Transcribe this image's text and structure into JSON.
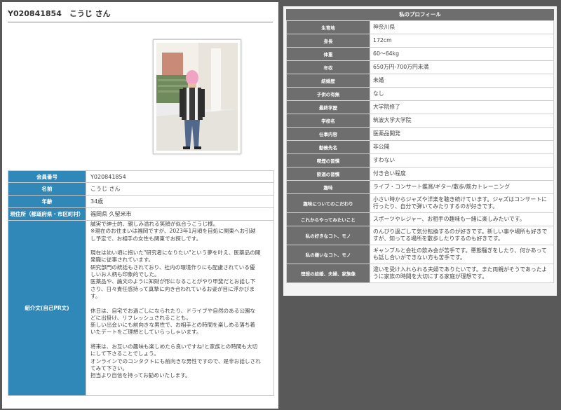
{
  "member": {
    "header": "Y020841854　こうじ さん",
    "rows": [
      {
        "label": "会員番号",
        "value": "Y020841854"
      },
      {
        "label": "名前",
        "value": "こうじ さん"
      },
      {
        "label": "年齢",
        "value": "34歳"
      },
      {
        "label": "現住所（都道府県・市区町村）",
        "value": "福岡県 久留米市"
      }
    ],
    "pr_label": "紹介文(自己PR文)",
    "pr_lines": [
      "誠実で紳士的、親しみ溢れる笑顔が似合うこうじ様。",
      "※現在のお住まいは福岡ですが、2023年1月頃を目処に関東へお引越",
      "し予定で、お相手の女性も関東でお探しです。",
      "",
      "現在は幼い頃に抱いた\"研究者になりたい\"という夢を叶え、医薬品の開",
      "発職に従事されています。",
      "研究部門の統括もされており、社内の環境作りにも配慮されている優",
      "しいお人柄も印象的でした。",
      "医薬品や、論文のように知財が形になることがやり甲斐だとお話し下",
      "さり、日々責任感持って真摯に向き合われているお姿が目に浮かびま",
      "す。",
      "",
      "休日は、自宅でお過ごしになられたり、ドライブや自然のある公園な",
      "どに出掛け、リフレッシュされることも。",
      "新しい出会いにも前向きな男性で、お相手との時間を楽しめる落ち着",
      "いたデートをご理想としていらっしゃいます。",
      "",
      "将来は、お互いの趣味も楽しめたら良いですね!と家族との時間も大切",
      "にして下さることでしょう。",
      "オンラインでのコンタクトにも前向きな男性ですので、是非お話しされ",
      "てみて下さい。",
      "担当より自信を持ってお勧めいたします。"
    ]
  },
  "profile": {
    "title": "私のプロフィール",
    "rows": [
      {
        "label": "生育地",
        "value": "神奈川県"
      },
      {
        "label": "身長",
        "value": "172cm"
      },
      {
        "label": "体重",
        "value": "60〜64kg"
      },
      {
        "label": "年収",
        "value": "650万円-700万円未満"
      },
      {
        "label": "結婚歴",
        "value": "未婚"
      },
      {
        "label": "子供の有無",
        "value": "なし"
      },
      {
        "label": "最終学歴",
        "value": "大学院修了"
      },
      {
        "label": "学校名",
        "value": "筑波大学大学院"
      },
      {
        "label": "仕事内容",
        "value": "医薬品開発"
      },
      {
        "label": "勤務先名",
        "value": "非公開"
      },
      {
        "label": "喫煙の習慣",
        "value": "すわない"
      },
      {
        "label": "飲酒の習慣",
        "value": "付き合い程度"
      },
      {
        "label": "趣味",
        "value": "ライブ・コンサート鑑賞/ギター/散歩/筋力トレーニング"
      },
      {
        "label": "趣味についてのこだわり",
        "value": "小さい時からジャズや洋楽を聴き続けています。ジャズはコンサートに行ったり、自分で弾いてみたりするのが好きです。"
      },
      {
        "label": "これからやってみたいこと",
        "value": "スポーツやレジャー、お相手の趣味も一緒に楽しみたいです。"
      },
      {
        "label": "私の好きなコト、モノ",
        "value": "のんびり過ごして気分転換するのが好きです。新しい事や場所も好きですが、知ってる場所を散歩したりするのも好きです。"
      },
      {
        "label": "私の嫌いなコト、モノ",
        "value": "ギャンブルと会社の飲み会が苦手です。悪態騒ぎをしたり、何かあっても話し合いができない方も苦手です。"
      },
      {
        "label": "理想の結婚、夫婦、家族像",
        "value": "違いを受け入れられる夫婦でありたいです。また両親がそうであったように家族の時間を大切にする家庭が理想です。"
      }
    ]
  }
}
